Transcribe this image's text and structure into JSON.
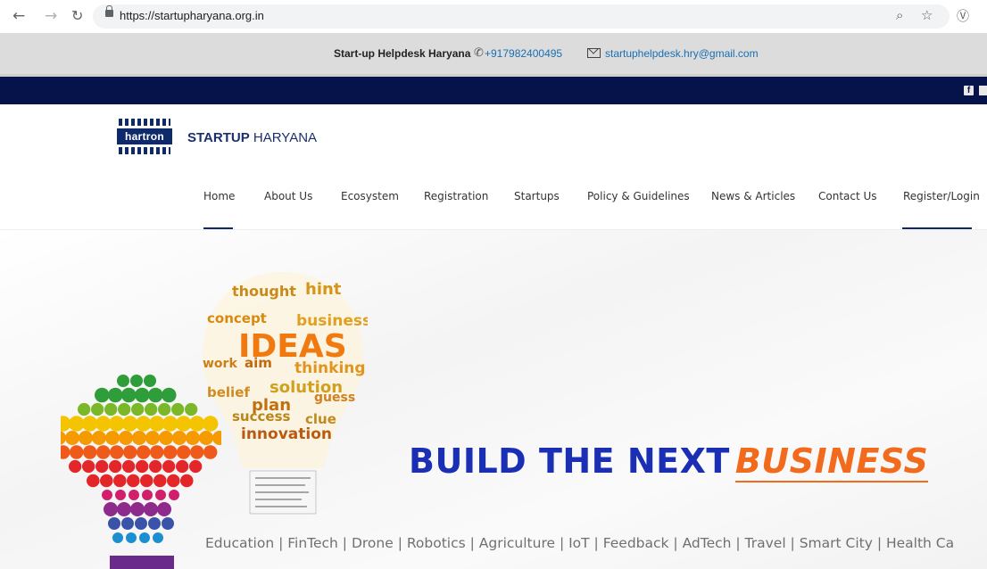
{
  "browser": {
    "url": "https://startupharyana.org.in",
    "icons": [
      "back-arrow-icon",
      "forward-arrow-icon",
      "reload-icon",
      "lock-icon",
      "zoom-icon",
      "star-icon",
      "extension-icon"
    ]
  },
  "helpdesk": {
    "title": "Start-up Helpdesk Haryana",
    "phone": "+917982400495",
    "email": "startuphelpdesk.hry@gmail.com"
  },
  "brand": {
    "logo_text": "hartron",
    "name_bold": "STARTUP",
    "name_rest": " HARYANA",
    "colors": {
      "navy": "#06124a",
      "logo_blue": "#0f2a6b"
    }
  },
  "nav": {
    "items": [
      {
        "label": "Home",
        "active": true
      },
      {
        "label": "About Us"
      },
      {
        "label": "Ecosystem"
      },
      {
        "label": "Registration"
      },
      {
        "label": "Startups"
      },
      {
        "label": "Policy & Guidelines"
      },
      {
        "label": "News & Articles"
      },
      {
        "label": "Contact Us"
      },
      {
        "label": "Register/Login",
        "active": true
      }
    ]
  },
  "hero": {
    "headline_main": "BUILD THE NEXT",
    "headline_accent": "BUSINESS",
    "headline_color": "#1a2fb3",
    "accent_color": "#f26b1d",
    "sectors": "Education | FinTech | Drone | Robotics | Agriculture | IoT | Feedback | AdTech | Travel | Smart City | Health Ca",
    "bulb_words": [
      "thought",
      "hint",
      "concept",
      "business",
      "IDEAS",
      "work",
      "aim",
      "thinking",
      "belief",
      "solution",
      "plan",
      "success",
      "innovation",
      "clue",
      "guess"
    ]
  }
}
